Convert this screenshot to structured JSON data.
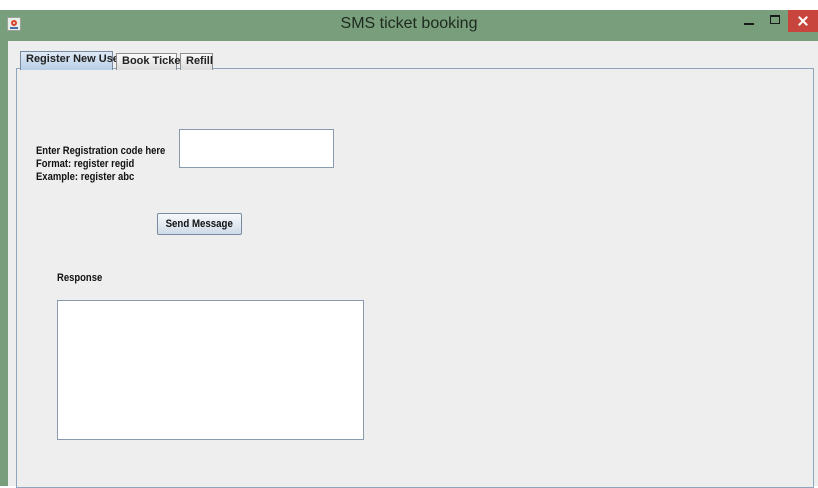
{
  "window": {
    "title": "SMS ticket booking",
    "icon": "java-cup-icon",
    "controls": [
      "minimize-icon",
      "maximize-icon",
      "close-icon"
    ]
  },
  "tabs": [
    {
      "label": "Register New User",
      "selected": true
    },
    {
      "label": "Book Ticket",
      "selected": false
    },
    {
      "label": "Refill",
      "selected": false
    }
  ],
  "register": {
    "instructions": [
      "Enter Registration code here",
      "Format: register regid",
      "Example: register abc"
    ],
    "code_input_value": "",
    "send_label": "Send Message",
    "response_label": "Response",
    "response_value": ""
  },
  "colors": {
    "titlebar": "#789e7c",
    "close": "#c7453c",
    "panel": "#eeeeee",
    "selected_tab": "#b8cfe6"
  }
}
